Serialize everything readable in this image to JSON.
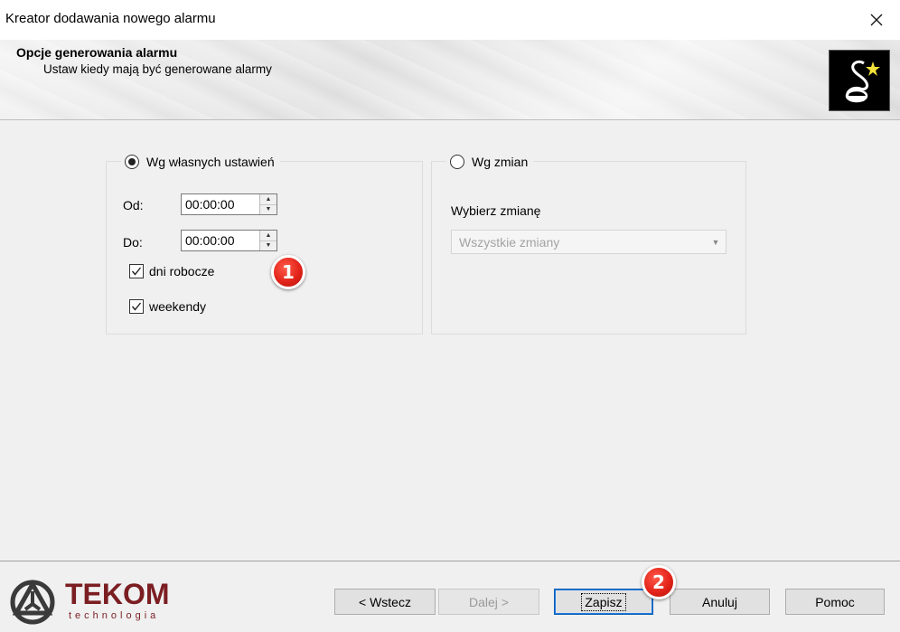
{
  "window": {
    "title": "Kreator dodawania nowego alarmu"
  },
  "banner": {
    "title": "Opcje generowania alarmu",
    "subtitle": "Ustaw kiedy mają być generowane alarmy"
  },
  "custom_group": {
    "radio_label": "Wg własnych ustawień",
    "selected": true,
    "from_label": "Od:",
    "from_value": "00:00:00",
    "to_label": "Do:",
    "to_value": "00:00:00",
    "workdays_label": "dni robocze",
    "workdays_checked": true,
    "weekends_label": "weekendy",
    "weekends_checked": true
  },
  "shifts_group": {
    "radio_label": "Wg zmian",
    "selected": false,
    "select_label": "Wybierz zmianę",
    "select_value": "Wszystkie zmiany"
  },
  "footer": {
    "logo_text": "TEKOM",
    "logo_subtext": "technologia",
    "back_label": "< Wstecz",
    "next_label": "Dalej >",
    "save_label": "Zapisz",
    "cancel_label": "Anuluj",
    "help_label": "Pomoc"
  },
  "markers": {
    "one": "1",
    "two": "2"
  },
  "colors": {
    "marker": "#e3241a",
    "logo": "#7b1e22",
    "panel": "#f0f0f0"
  }
}
